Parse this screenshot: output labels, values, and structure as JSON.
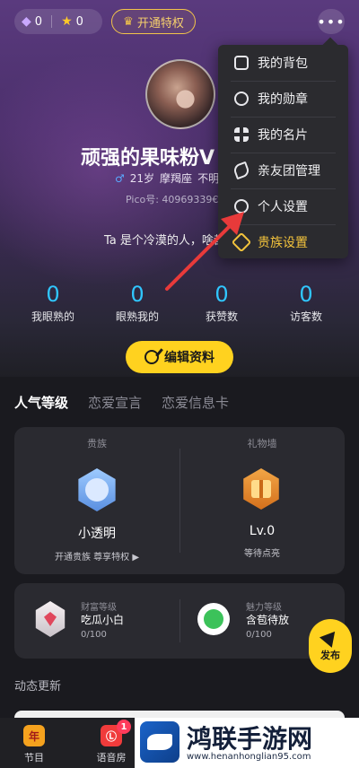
{
  "topbar": {
    "diamond_count": "0",
    "star_count": "0",
    "vip_label": "开通特权",
    "more_label": "•••"
  },
  "profile": {
    "nickname": "顽强的果味粉V",
    "age": "21岁",
    "zodiac": "摩羯座",
    "location": "不明所",
    "pico_id": "Pico号: 40969339€",
    "bio": "Ta 是个冷漠的人，啥都"
  },
  "stats": [
    {
      "value": "0",
      "label": "我眼熟的"
    },
    {
      "value": "0",
      "label": "眼熟我的"
    },
    {
      "value": "0",
      "label": "获赞数"
    },
    {
      "value": "0",
      "label": "访客数"
    }
  ],
  "edit_button": "编辑资料",
  "tabs": [
    {
      "label": "人气等级",
      "active": true
    },
    {
      "label": "恋爱宣言",
      "active": false
    },
    {
      "label": "恋爱信息卡",
      "active": false
    }
  ],
  "noble_card": {
    "noble": {
      "title": "贵族",
      "name": "小透明",
      "sub": "开通贵族 尊享特权 ▶"
    },
    "gift_wall": {
      "title": "礼物墙",
      "name": "Lv.0",
      "sub": "等待点亮"
    }
  },
  "level_card": {
    "wealth": {
      "title": "财富等级",
      "name": "吃瓜小白",
      "count": "0/100"
    },
    "charm": {
      "title": "魅力等级",
      "name": "含苞待放",
      "count": "0/100"
    }
  },
  "publish_button": "发布",
  "updates_title": "动态更新",
  "bottom_nav": [
    {
      "label": "节目",
      "icon_text": "年"
    },
    {
      "label": "语音房",
      "icon_text": "Ⓛ",
      "badge": "1"
    }
  ],
  "menu": [
    {
      "label": "我的背包",
      "icon": "backpack-icon"
    },
    {
      "label": "我的勋章",
      "icon": "medal-icon"
    },
    {
      "label": "我的名片",
      "icon": "card-grid-icon"
    },
    {
      "label": "亲友团管理",
      "icon": "handshake-icon"
    },
    {
      "label": "个人设置",
      "icon": "settings-hex-icon"
    },
    {
      "label": "贵族设置",
      "icon": "noble-diamond-icon"
    }
  ],
  "watermark": {
    "title": "鸿联手游网",
    "url": "www.henanhonglian95.com"
  },
  "colors": {
    "accent_yellow": "#ffd21f",
    "stat_blue": "#30c6ff",
    "gold": "#f3c33c",
    "annotation_red": "#e83a3a"
  }
}
